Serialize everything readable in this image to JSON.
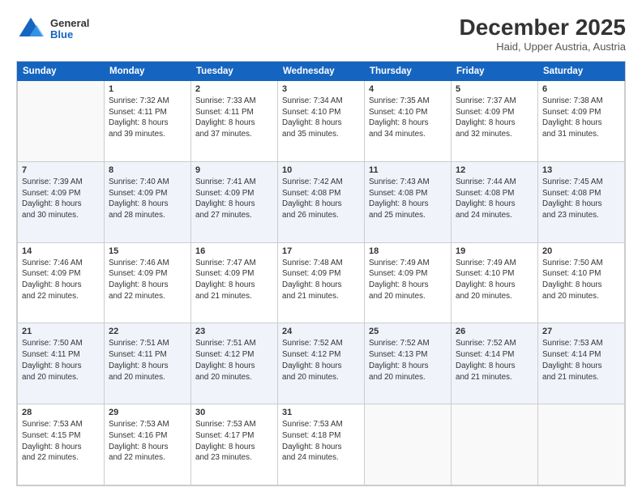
{
  "header": {
    "logo_general": "General",
    "logo_blue": "Blue",
    "main_title": "December 2025",
    "subtitle": "Haid, Upper Austria, Austria"
  },
  "days_of_week": [
    "Sunday",
    "Monday",
    "Tuesday",
    "Wednesday",
    "Thursday",
    "Friday",
    "Saturday"
  ],
  "weeks": [
    [
      {
        "day": "",
        "detail": ""
      },
      {
        "day": "1",
        "detail": "Sunrise: 7:32 AM\nSunset: 4:11 PM\nDaylight: 8 hours\nand 39 minutes."
      },
      {
        "day": "2",
        "detail": "Sunrise: 7:33 AM\nSunset: 4:11 PM\nDaylight: 8 hours\nand 37 minutes."
      },
      {
        "day": "3",
        "detail": "Sunrise: 7:34 AM\nSunset: 4:10 PM\nDaylight: 8 hours\nand 35 minutes."
      },
      {
        "day": "4",
        "detail": "Sunrise: 7:35 AM\nSunset: 4:10 PM\nDaylight: 8 hours\nand 34 minutes."
      },
      {
        "day": "5",
        "detail": "Sunrise: 7:37 AM\nSunset: 4:09 PM\nDaylight: 8 hours\nand 32 minutes."
      },
      {
        "day": "6",
        "detail": "Sunrise: 7:38 AM\nSunset: 4:09 PM\nDaylight: 8 hours\nand 31 minutes."
      }
    ],
    [
      {
        "day": "7",
        "detail": "Sunrise: 7:39 AM\nSunset: 4:09 PM\nDaylight: 8 hours\nand 30 minutes."
      },
      {
        "day": "8",
        "detail": "Sunrise: 7:40 AM\nSunset: 4:09 PM\nDaylight: 8 hours\nand 28 minutes."
      },
      {
        "day": "9",
        "detail": "Sunrise: 7:41 AM\nSunset: 4:09 PM\nDaylight: 8 hours\nand 27 minutes."
      },
      {
        "day": "10",
        "detail": "Sunrise: 7:42 AM\nSunset: 4:08 PM\nDaylight: 8 hours\nand 26 minutes."
      },
      {
        "day": "11",
        "detail": "Sunrise: 7:43 AM\nSunset: 4:08 PM\nDaylight: 8 hours\nand 25 minutes."
      },
      {
        "day": "12",
        "detail": "Sunrise: 7:44 AM\nSunset: 4:08 PM\nDaylight: 8 hours\nand 24 minutes."
      },
      {
        "day": "13",
        "detail": "Sunrise: 7:45 AM\nSunset: 4:08 PM\nDaylight: 8 hours\nand 23 minutes."
      }
    ],
    [
      {
        "day": "14",
        "detail": "Sunrise: 7:46 AM\nSunset: 4:09 PM\nDaylight: 8 hours\nand 22 minutes."
      },
      {
        "day": "15",
        "detail": "Sunrise: 7:46 AM\nSunset: 4:09 PM\nDaylight: 8 hours\nand 22 minutes."
      },
      {
        "day": "16",
        "detail": "Sunrise: 7:47 AM\nSunset: 4:09 PM\nDaylight: 8 hours\nand 21 minutes."
      },
      {
        "day": "17",
        "detail": "Sunrise: 7:48 AM\nSunset: 4:09 PM\nDaylight: 8 hours\nand 21 minutes."
      },
      {
        "day": "18",
        "detail": "Sunrise: 7:49 AM\nSunset: 4:09 PM\nDaylight: 8 hours\nand 20 minutes."
      },
      {
        "day": "19",
        "detail": "Sunrise: 7:49 AM\nSunset: 4:10 PM\nDaylight: 8 hours\nand 20 minutes."
      },
      {
        "day": "20",
        "detail": "Sunrise: 7:50 AM\nSunset: 4:10 PM\nDaylight: 8 hours\nand 20 minutes."
      }
    ],
    [
      {
        "day": "21",
        "detail": "Sunrise: 7:50 AM\nSunset: 4:11 PM\nDaylight: 8 hours\nand 20 minutes."
      },
      {
        "day": "22",
        "detail": "Sunrise: 7:51 AM\nSunset: 4:11 PM\nDaylight: 8 hours\nand 20 minutes."
      },
      {
        "day": "23",
        "detail": "Sunrise: 7:51 AM\nSunset: 4:12 PM\nDaylight: 8 hours\nand 20 minutes."
      },
      {
        "day": "24",
        "detail": "Sunrise: 7:52 AM\nSunset: 4:12 PM\nDaylight: 8 hours\nand 20 minutes."
      },
      {
        "day": "25",
        "detail": "Sunrise: 7:52 AM\nSunset: 4:13 PM\nDaylight: 8 hours\nand 20 minutes."
      },
      {
        "day": "26",
        "detail": "Sunrise: 7:52 AM\nSunset: 4:14 PM\nDaylight: 8 hours\nand 21 minutes."
      },
      {
        "day": "27",
        "detail": "Sunrise: 7:53 AM\nSunset: 4:14 PM\nDaylight: 8 hours\nand 21 minutes."
      }
    ],
    [
      {
        "day": "28",
        "detail": "Sunrise: 7:53 AM\nSunset: 4:15 PM\nDaylight: 8 hours\nand 22 minutes."
      },
      {
        "day": "29",
        "detail": "Sunrise: 7:53 AM\nSunset: 4:16 PM\nDaylight: 8 hours\nand 22 minutes."
      },
      {
        "day": "30",
        "detail": "Sunrise: 7:53 AM\nSunset: 4:17 PM\nDaylight: 8 hours\nand 23 minutes."
      },
      {
        "day": "31",
        "detail": "Sunrise: 7:53 AM\nSunset: 4:18 PM\nDaylight: 8 hours\nand 24 minutes."
      },
      {
        "day": "",
        "detail": ""
      },
      {
        "day": "",
        "detail": ""
      },
      {
        "day": "",
        "detail": ""
      }
    ]
  ]
}
